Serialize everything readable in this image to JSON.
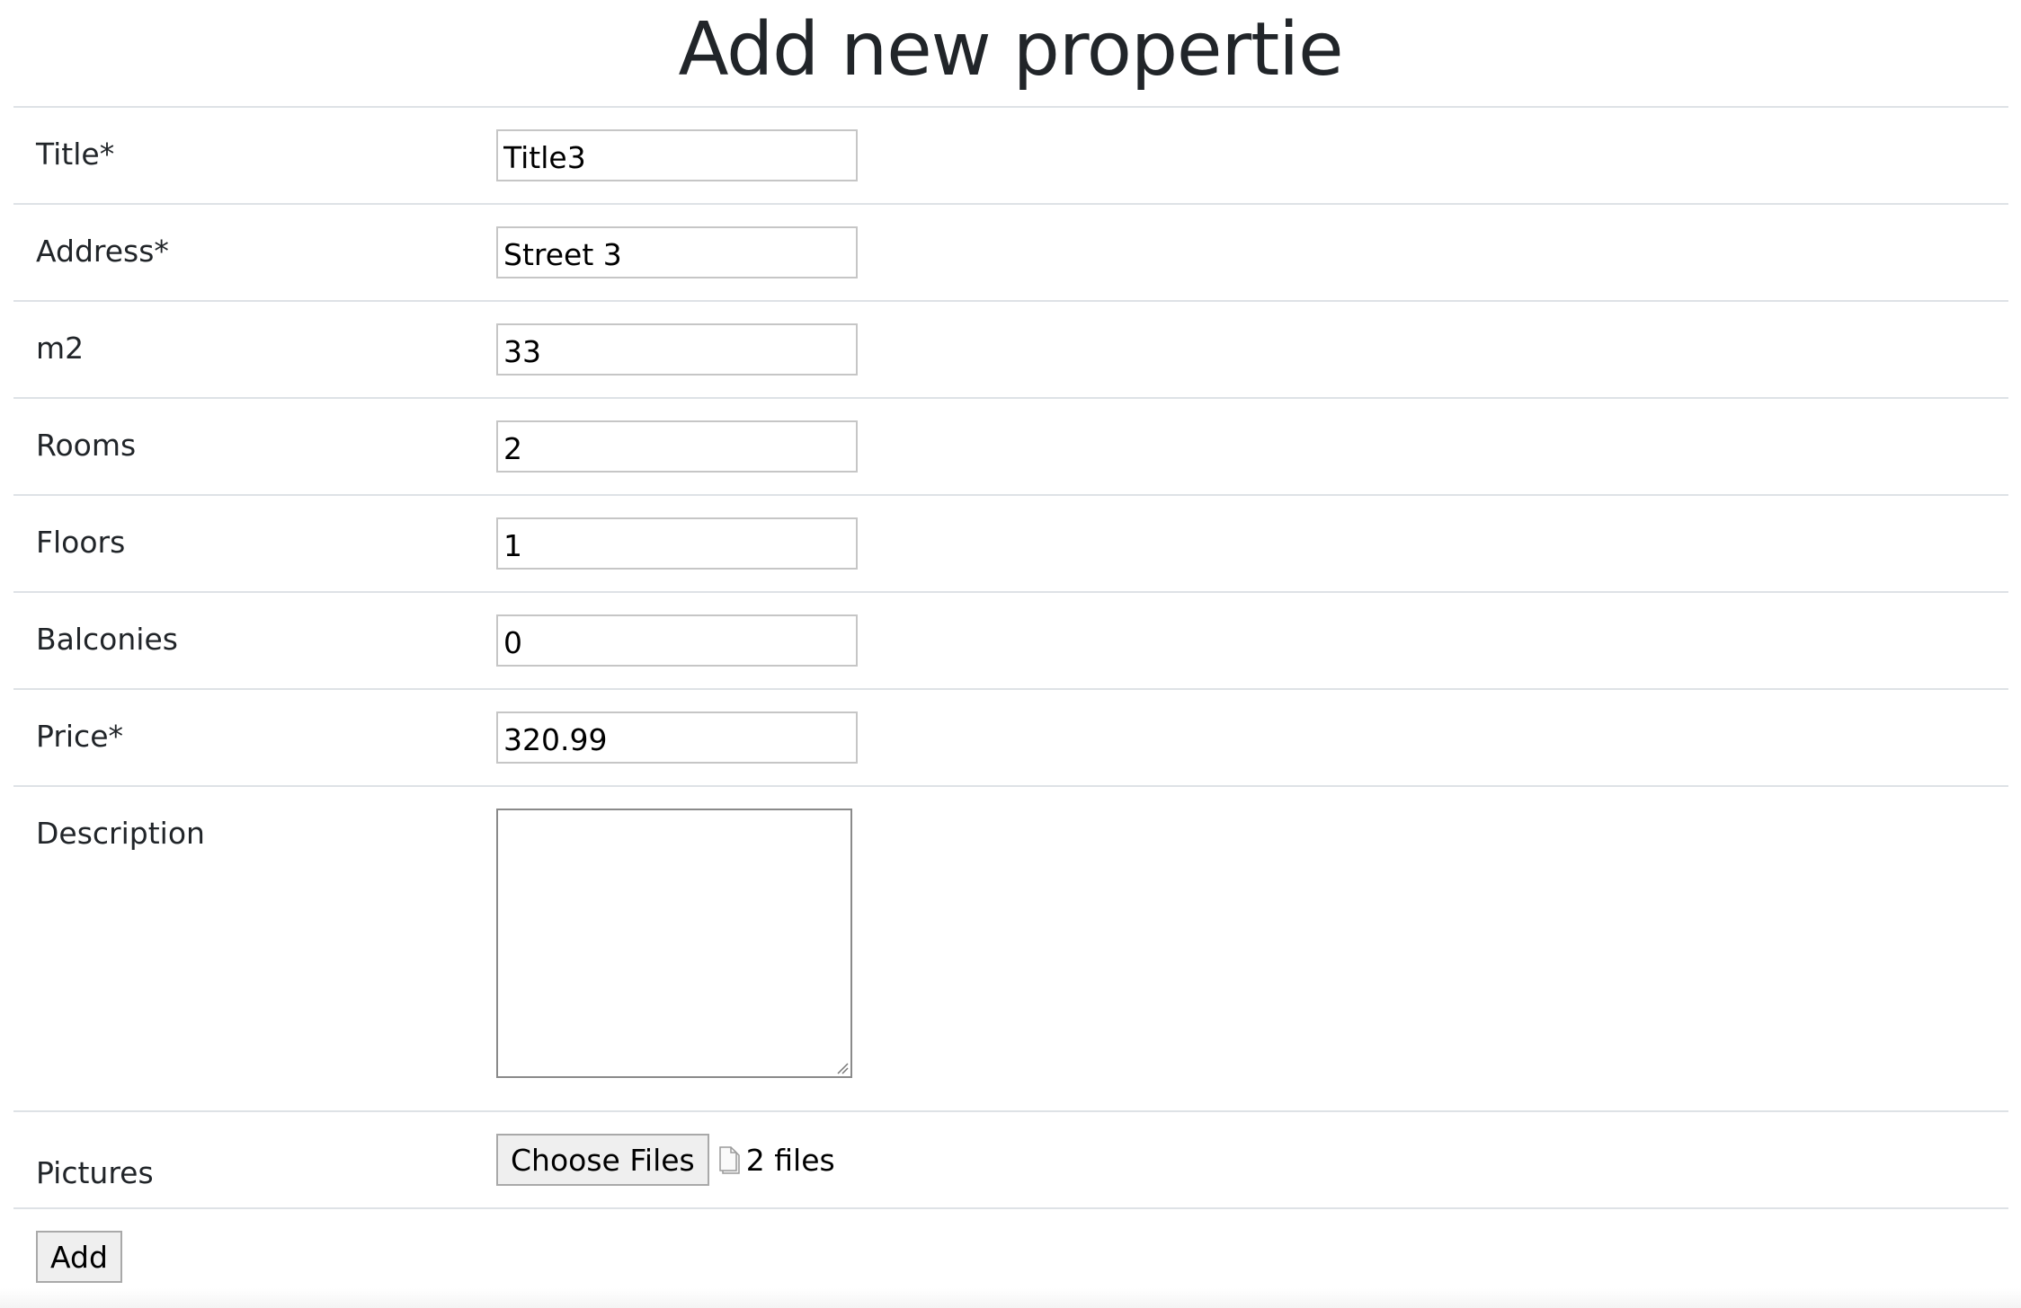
{
  "page": {
    "title": "Add new propertie"
  },
  "form": {
    "fields": [
      {
        "label": "Title*",
        "value": "Title3"
      },
      {
        "label": "Address*",
        "value": "Street 3"
      },
      {
        "label": "m2",
        "value": "33"
      },
      {
        "label": "Rooms",
        "value": "2"
      },
      {
        "label": "Floors",
        "value": "1"
      },
      {
        "label": "Balconies",
        "value": "0"
      },
      {
        "label": "Price*",
        "value": "320.99"
      }
    ],
    "description": {
      "label": "Description",
      "value": ""
    },
    "pictures": {
      "label": "Pictures",
      "button_label": "Choose Files",
      "file_icon": "file-icon",
      "status": "2 files"
    },
    "submit_label": "Add"
  },
  "colors": {
    "divider": "#dee2e6",
    "text": "#212529",
    "button_bg": "#efefef"
  }
}
